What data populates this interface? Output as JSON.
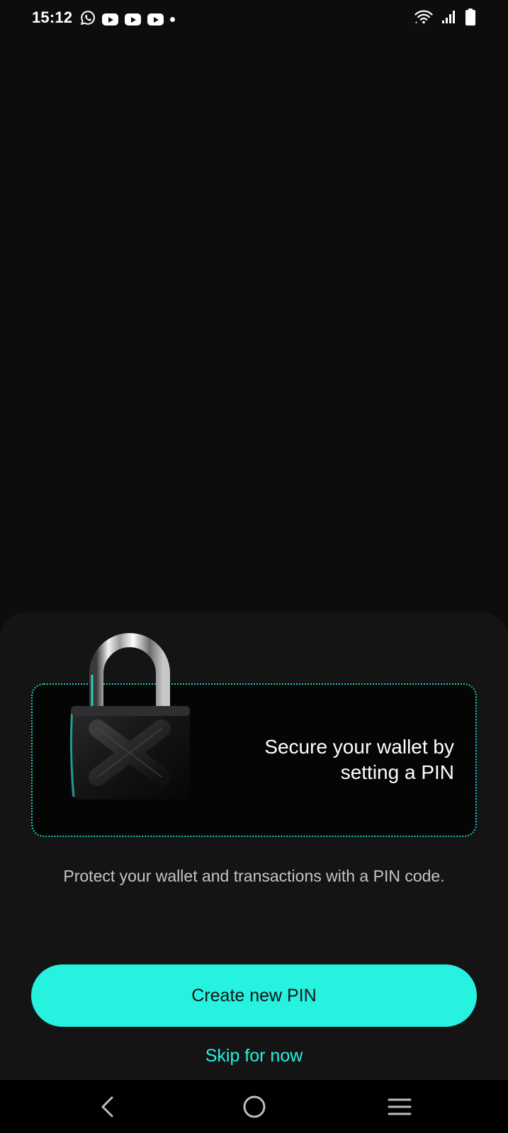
{
  "status_bar": {
    "time": "15:12",
    "notification_icons": [
      "whatsapp-icon",
      "youtube-icon",
      "youtube-icon",
      "youtube-icon",
      "dot-icon"
    ],
    "system_icons": [
      "wifi-icon",
      "signal-icon",
      "battery-icon"
    ]
  },
  "pin_setup": {
    "card_title": "Secure your wallet by setting a PIN",
    "card_illustration": "padlock-icon",
    "description": "Protect your wallet and transactions with a PIN code.",
    "primary_button_label": "Create new PIN",
    "skip_label": "Skip for now"
  },
  "navigation_bar": {
    "buttons": [
      "back-icon",
      "home-icon",
      "recent-apps-icon"
    ]
  },
  "colors": {
    "accent": "#26F2DF",
    "background": "#0D0D0E",
    "sheet": "#141415",
    "card": "#050505"
  }
}
